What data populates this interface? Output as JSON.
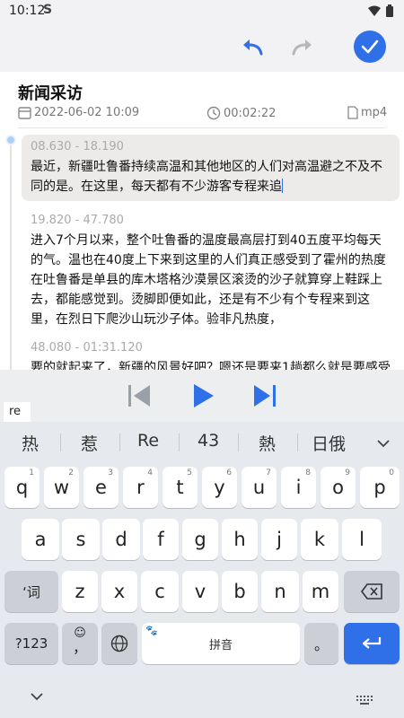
{
  "status_bar": {
    "time": "10:12",
    "carrier_icon_text": "S"
  },
  "toolbar": {
    "undo_icon": "undo-icon",
    "redo_icon": "redo-icon",
    "confirm_icon": "check-icon",
    "accent_color": "#2f6fe8"
  },
  "record": {
    "title": "新闻采访",
    "date": "2022-06-02 10:09",
    "duration": "00:02:22",
    "format": "mp4"
  },
  "transcript": {
    "segments": [
      {
        "time": "08.630 - 18.190",
        "text": "最近，新疆吐鲁番持续高温和其他地区的人们对高温避之不及不同的是。在这里，每天都有不少游客专程来追",
        "active": true
      },
      {
        "time": "19.820 - 47.780",
        "text": "进入7个月以来，整个吐鲁番的温度最高层打到40五度平均每天的气。温也在40度上下来到这里的人们真正感受到了霍州的热度在吐鲁番是单县的库木塔格沙漠景区滚烫的沙子就算穿上鞋踩上去，都能感觉到。烫脚即便如此，还是有不少有个专程来到这里，在烈日下爬沙山玩沙子体。验非凡热度，",
        "active": false
      },
      {
        "time": "48.080 - 01:31.120",
        "text": "要的就起来了，新疆的风景好吧？嗯还是要来1趟都么就是要感受",
        "active": false
      }
    ]
  },
  "player": {
    "prev_icon": "skip-previous-icon",
    "play_icon": "play-icon",
    "next_icon": "skip-next-icon"
  },
  "ime": {
    "composing_text": "re",
    "candidates": [
      "热",
      "惹",
      "Re",
      "43",
      "熱",
      "日俄"
    ],
    "rows": [
      [
        {
          "label": "q",
          "hint": "1"
        },
        {
          "label": "w",
          "hint": "2"
        },
        {
          "label": "e",
          "hint": "3"
        },
        {
          "label": "r",
          "hint": "4"
        },
        {
          "label": "t",
          "hint": "5"
        },
        {
          "label": "y",
          "hint": "6"
        },
        {
          "label": "u",
          "hint": "7"
        },
        {
          "label": "i",
          "hint": "8"
        },
        {
          "label": "o",
          "hint": "9"
        },
        {
          "label": "p",
          "hint": "0"
        }
      ],
      [
        {
          "label": "a"
        },
        {
          "label": "s"
        },
        {
          "label": "d"
        },
        {
          "label": "f"
        },
        {
          "label": "g"
        },
        {
          "label": "h"
        },
        {
          "label": "j"
        },
        {
          "label": "k"
        },
        {
          "label": "l"
        }
      ],
      [
        {
          "label": "z"
        },
        {
          "label": "x"
        },
        {
          "label": "c"
        },
        {
          "label": "v"
        },
        {
          "label": "b"
        },
        {
          "label": "n"
        },
        {
          "label": "m"
        }
      ]
    ],
    "shift_label": "‘词",
    "symbols_label": "?123",
    "emoji_top": "☺",
    "comma_label": "，",
    "space_label": "拼音",
    "period_label": "。",
    "enter_icon": "enter-arrow-icon",
    "backspace_icon": "backspace-icon",
    "globe_icon": "globe-icon"
  }
}
